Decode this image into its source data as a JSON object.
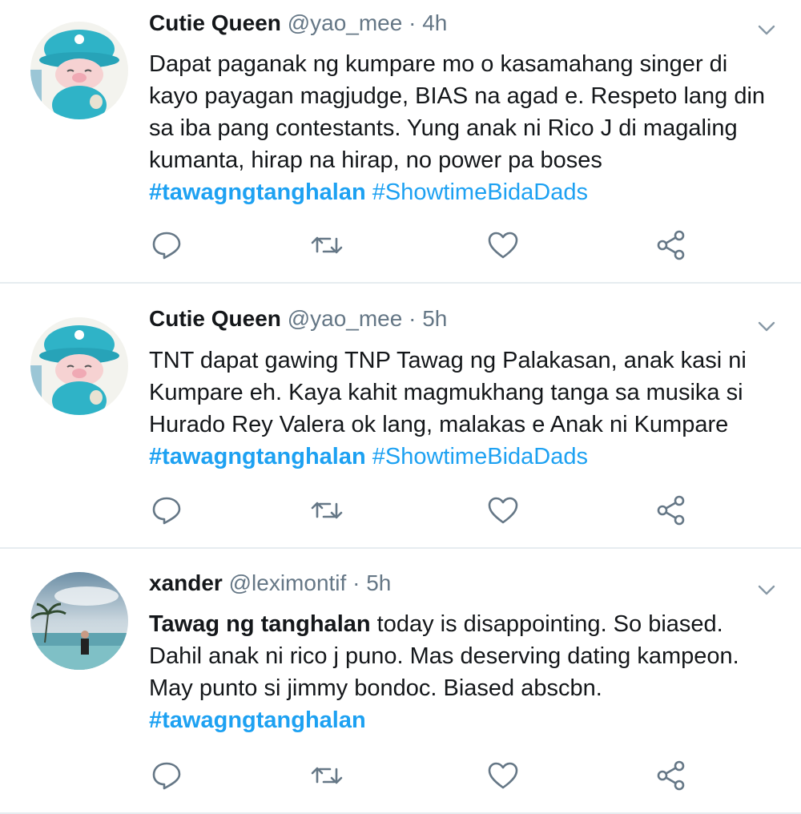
{
  "tweets": [
    {
      "name": "Cutie Queen",
      "handle": "@yao_mee",
      "separator": "·",
      "time": "4h",
      "avatar_icon": "pig-plush-avatar",
      "text_plain": "Dapat paganak ng kumpare mo o kasamahang singer di kayo payagan magjudge, BIAS na agad e. Respeto lang din sa iba pang contestants. Yung anak ni Rico J di magaling kumanta, hirap na hirap, no power pa boses",
      "hashtag_1": "#tawagngtanghalan",
      "hashtag_2": "#ShowtimeBidaDads"
    },
    {
      "name": "Cutie Queen",
      "handle": "@yao_mee",
      "separator": "·",
      "time": "5h",
      "avatar_icon": "pig-plush-avatar",
      "text_plain": "TNT dapat gawing TNP  Tawag ng Palakasan, anak kasi ni Kumpare eh.  Kaya kahit magmukhang tanga sa musika si Hurado Rey Valera ok lang, malakas e Anak ni Kumpare",
      "hashtag_1": "#tawagngtanghalan",
      "hashtag_2": "#ShowtimeBidaDads"
    },
    {
      "name": "xander",
      "handle": "@leximontif",
      "separator": "·",
      "time": "5h",
      "avatar_icon": "beach-photo-avatar",
      "text_bold": "Tawag ng tanghalan",
      "text_plain": " today is disappointing. So biased. Dahil anak ni rico j puno. Mas deserving dating kampeon. May punto si jimmy bondoc. Biased abscbn.",
      "hashtag_1": "#tawagngtanghalan"
    }
  ],
  "actions": [
    "reply-icon",
    "retweet-icon",
    "like-icon",
    "share-icon"
  ],
  "colors": {
    "hashtag": "#1da1f2",
    "secondary_text": "#657786",
    "divider": "#e6ecf0"
  }
}
